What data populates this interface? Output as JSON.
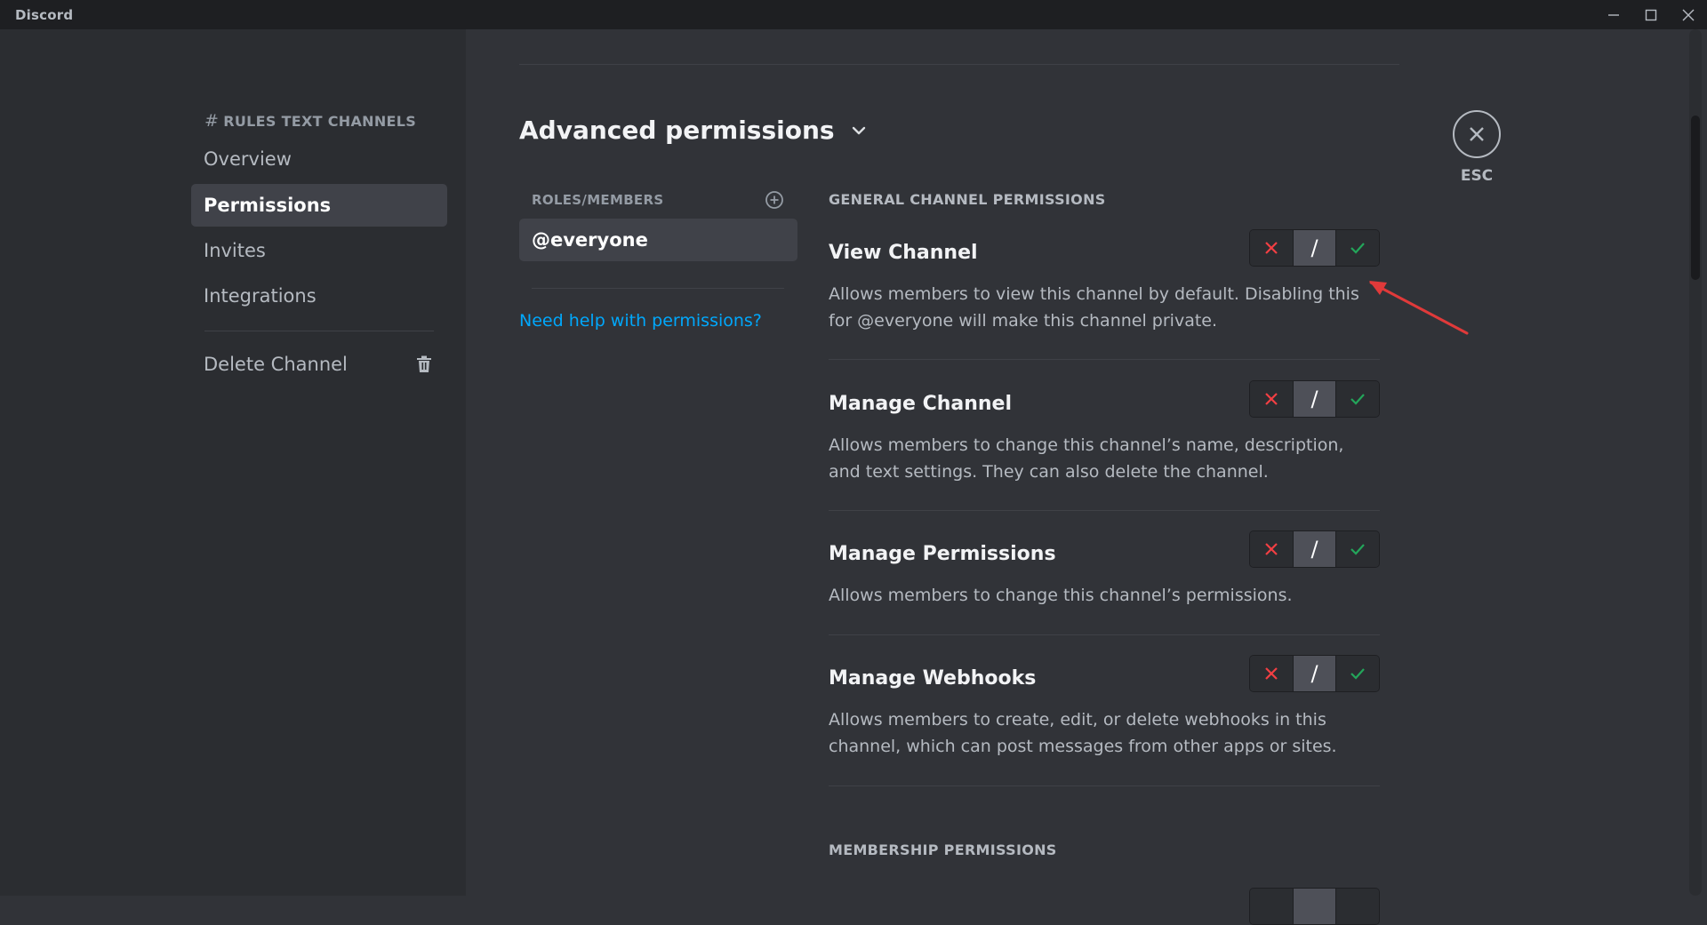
{
  "window": {
    "app_name": "Discord"
  },
  "sidebar": {
    "header_hash": "#",
    "header_label": "RULES TEXT CHANNELS",
    "items": [
      {
        "label": "Overview",
        "active": false
      },
      {
        "label": "Permissions",
        "active": true
      },
      {
        "label": "Invites",
        "active": false
      },
      {
        "label": "Integrations",
        "active": false
      }
    ],
    "delete_label": "Delete Channel"
  },
  "main": {
    "title": "Advanced permissions",
    "roles_header": "ROLES/MEMBERS",
    "selected_role": "@everyone",
    "help_link": "Need help with permissions?",
    "sections": [
      {
        "header": "GENERAL CHANNEL PERMISSIONS"
      },
      {
        "header": "MEMBERSHIP PERMISSIONS"
      }
    ],
    "permissions": [
      {
        "name": "View Channel",
        "description": "Allows members to view this channel by default. Disabling this for @everyone will make this channel private.",
        "state": "neutral"
      },
      {
        "name": "Manage Channel",
        "description": "Allows members to change this channel’s name, description, and text settings. They can also delete the channel.",
        "state": "neutral"
      },
      {
        "name": "Manage Permissions",
        "description": "Allows members to change this channel’s permissions.",
        "state": "neutral"
      },
      {
        "name": "Manage Webhooks",
        "description": "Allows members to create, edit, or delete webhooks in this channel, which can post messages from other apps or sites.",
        "state": "neutral"
      }
    ],
    "toggle_neutral_glyph": "/"
  },
  "esc": {
    "label": "ESC"
  },
  "colors": {
    "deny": "#f23f43",
    "allow": "#23a55a",
    "link": "#00a8fc",
    "annotation_arrow": "#e03a3a"
  }
}
